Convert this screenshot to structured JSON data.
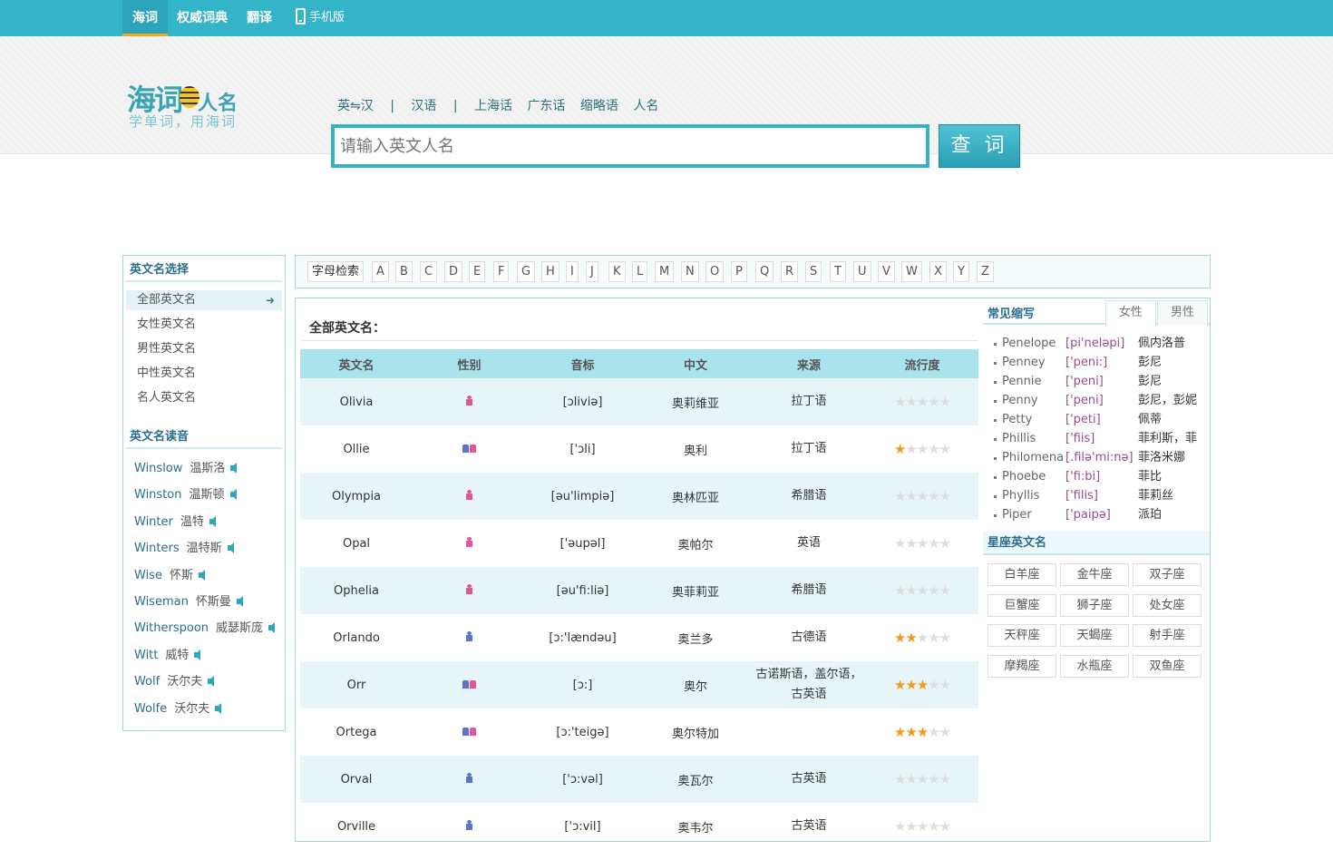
{
  "topnav": {
    "items": [
      "海词",
      "权威词典",
      "翻译"
    ],
    "mobile": "手机版"
  },
  "logo": {
    "brand": "海词",
    "sub": "人名",
    "slogan": "学单词，用海词"
  },
  "search": {
    "tabs": [
      "英⇋汉",
      "|",
      "汉语",
      "|",
      "上海话",
      "广东话",
      "缩略语",
      "人名"
    ],
    "placeholder": "请输入英文人名",
    "button": "查 词"
  },
  "sidebar": {
    "title1": "英文名选择",
    "items": [
      "全部英文名",
      "女性英文名",
      "男性英文名",
      "中性英文名",
      "名人英文名"
    ],
    "title2": "英文名读音",
    "pron": [
      {
        "en": "Winslow",
        "zh": "温斯洛"
      },
      {
        "en": "Winston",
        "zh": "温斯顿"
      },
      {
        "en": "Winter",
        "zh": "温特"
      },
      {
        "en": "Winters",
        "zh": "温特斯"
      },
      {
        "en": "Wise",
        "zh": "怀斯"
      },
      {
        "en": "Wiseman",
        "zh": "怀斯曼"
      },
      {
        "en": "Witherspoon",
        "zh": "威瑟斯庞"
      },
      {
        "en": "Witt",
        "zh": "威特"
      },
      {
        "en": "Wolf",
        "zh": "沃尔夫"
      },
      {
        "en": "Wolfe",
        "zh": "沃尔夫"
      }
    ]
  },
  "alpha": {
    "label": "字母检索",
    "letters": [
      "A",
      "B",
      "C",
      "D",
      "E",
      "F",
      "G",
      "H",
      "I",
      "J",
      "K",
      "L",
      "M",
      "N",
      "O",
      "P",
      "Q",
      "R",
      "S",
      "T",
      "U",
      "V",
      "W",
      "X",
      "Y",
      "Z"
    ]
  },
  "main": {
    "title": "全部英文名：",
    "columns": [
      "英文名",
      "性别",
      "音标",
      "中文",
      "来源",
      "流行度"
    ],
    "rows": [
      {
        "name": "Olivia",
        "gender": "female",
        "ipa": "[ɔliviə]",
        "zh": "奥莉维亚",
        "src": "拉丁语",
        "pop": 0
      },
      {
        "name": "Ollie",
        "gender": "unisex",
        "ipa": "['ɔli]",
        "zh": "奥利",
        "src": "拉丁语",
        "pop": 1
      },
      {
        "name": "Olympia",
        "gender": "female",
        "ipa": "[əu'limpiə]",
        "zh": "奥林匹亚",
        "src": "希腊语",
        "pop": 0
      },
      {
        "name": "Opal",
        "gender": "female",
        "ipa": "['əupəl]",
        "zh": "奥帕尔",
        "src": "英语",
        "pop": 0
      },
      {
        "name": "Ophelia",
        "gender": "female",
        "ipa": "[əu'fi:liə]",
        "zh": "奥菲莉亚",
        "src": "希腊语",
        "pop": 0
      },
      {
        "name": "Orlando",
        "gender": "male",
        "ipa": "[ɔ:'lændəu]",
        "zh": "奥兰多",
        "src": "古德语",
        "pop": 2
      },
      {
        "name": "Orr",
        "gender": "unisex",
        "ipa": "[ɔ:]",
        "zh": "奥尔",
        "src": "古诺斯语，盖尔语，古英语",
        "pop": 3
      },
      {
        "name": "Ortega",
        "gender": "unisex",
        "ipa": "[ɔ:'teigə]",
        "zh": "奥尔特加",
        "src": "",
        "pop": 3
      },
      {
        "name": "Orval",
        "gender": "male",
        "ipa": "['ɔ:vəl]",
        "zh": "奥瓦尔",
        "src": "古英语",
        "pop": 0
      },
      {
        "name": "Orville",
        "gender": "male",
        "ipa": "['ɔ:vil]",
        "zh": "奥韦尔",
        "src": "古英语",
        "pop": 0
      }
    ]
  },
  "abbr": {
    "title": "常见缩写",
    "tabs": [
      "女性",
      "男性"
    ],
    "items": [
      {
        "n": "Penelope",
        "p": "[pi'neləpi]",
        "z": "佩内洛普"
      },
      {
        "n": "Penney",
        "p": "['peni:]",
        "z": "彭尼"
      },
      {
        "n": "Pennie",
        "p": "['peni]",
        "z": "彭尼"
      },
      {
        "n": "Penny",
        "p": "['peni]",
        "z": "彭尼，彭妮"
      },
      {
        "n": "Petty",
        "p": "['peti]",
        "z": "佩蒂"
      },
      {
        "n": "Phillis",
        "p": "['fiis]",
        "z": "菲利斯，菲"
      },
      {
        "n": "Philomena",
        "p": "[.filə'mi:nə]",
        "z": "菲洛米娜"
      },
      {
        "n": "Phoebe",
        "p": "['fi:bi]",
        "z": "菲比"
      },
      {
        "n": "Phyllis",
        "p": "['filis]",
        "z": "菲莉丝"
      },
      {
        "n": "Piper",
        "p": "['paipə]",
        "z": "派珀"
      }
    ]
  },
  "zodiac": {
    "title": "星座英文名",
    "items": [
      "白羊座",
      "金牛座",
      "双子座",
      "巨蟹座",
      "狮子座",
      "处女座",
      "天秤座",
      "天蝎座",
      "射手座",
      "摩羯座",
      "水瓶座",
      "双鱼座"
    ]
  },
  "colors": {
    "brand": "#33b4c9",
    "accent": "#f5a623",
    "ipa": "#9a4b88",
    "star": "#f39a1c"
  }
}
